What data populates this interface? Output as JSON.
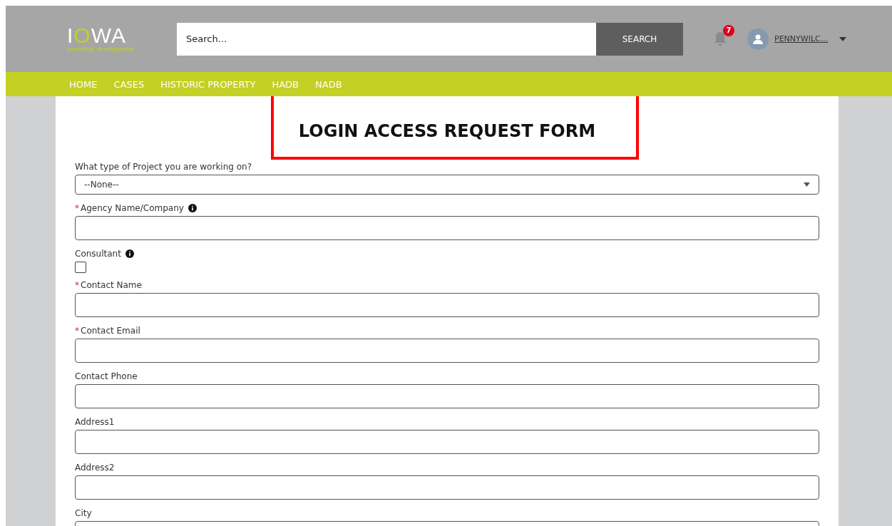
{
  "header": {
    "logo": {
      "text": "IOWA",
      "tagline": "economic development"
    },
    "search": {
      "placeholder": "Search...",
      "button": "SEARCH"
    },
    "notifications": {
      "count": "7"
    },
    "user": {
      "name": "PENNYWILC..."
    }
  },
  "nav": [
    {
      "label": "HOME"
    },
    {
      "label": "CASES"
    },
    {
      "label": "HISTORIC PROPERTY"
    },
    {
      "label": "HADB"
    },
    {
      "label": "NADB"
    }
  ],
  "form": {
    "title": "LOGIN ACCESS REQUEST FORM",
    "highlighted": true,
    "fields": [
      {
        "kind": "select",
        "label": "What type of Project you are working on?",
        "info": false,
        "value": "--None--"
      },
      {
        "kind": "text",
        "label": "Agency Name/Company",
        "required_mark": "*",
        "info": true
      },
      {
        "kind": "checkbox",
        "label": "Consultant",
        "info": true,
        "checked": false
      },
      {
        "kind": "text",
        "label": "Contact Name",
        "required_mark": "*",
        "info": false
      },
      {
        "kind": "text",
        "label": "Contact Email",
        "required_mark": "*",
        "info": false
      },
      {
        "kind": "text",
        "label": "Contact Phone",
        "info": false
      },
      {
        "kind": "text",
        "label": "Address1",
        "info": false
      },
      {
        "kind": "text",
        "label": "Address2",
        "info": false
      },
      {
        "kind": "text",
        "label": "City",
        "info": false
      }
    ]
  }
}
